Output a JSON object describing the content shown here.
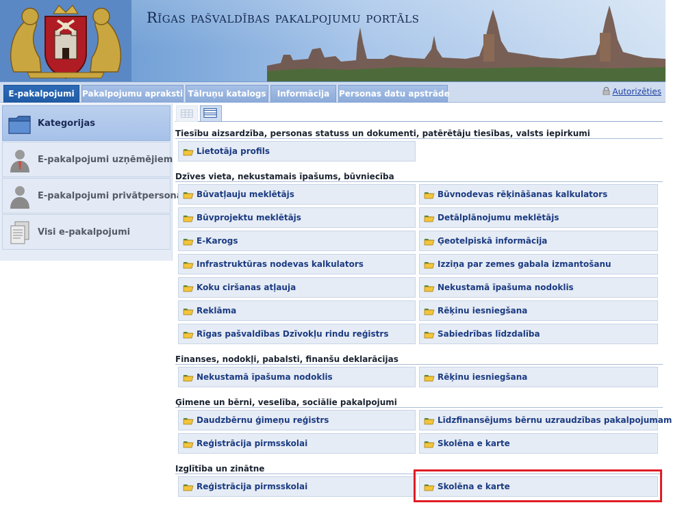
{
  "header": {
    "title": "Rīgas pašvaldības pakalpojumu portāls",
    "coat_of_arms_icon": "riga-coat-of-arms-icon",
    "skyline_icon": "riga-skyline-image"
  },
  "tabs": [
    {
      "label": "E-pakalpojumi",
      "active": true
    },
    {
      "label": "Pakalpojumu apraksti",
      "active": false
    },
    {
      "label": "Tālruņu katalogs",
      "active": false
    },
    {
      "label": "Informācija",
      "active": false
    },
    {
      "label": "Personas datu apstrāde",
      "active": false
    }
  ],
  "auth": {
    "label": "Autorizēties",
    "icon": "lock-icon"
  },
  "sidebar": {
    "items": [
      {
        "label": "Kategorijas",
        "icon": "folder-icon",
        "active": true
      },
      {
        "label": "E-pakalpojumi uzņēmējiem",
        "icon": "business-person-icon",
        "active": false
      },
      {
        "label": "E-pakalpojumi privātpersonām",
        "icon": "person-icon",
        "active": false
      },
      {
        "label": "Visi e-pakalpojumi",
        "icon": "documents-icon",
        "active": false
      }
    ]
  },
  "view_toggle": {
    "options": [
      "list-view",
      "grid-view"
    ],
    "selected": "grid-view"
  },
  "categories": [
    {
      "title": "Tiesību aizsardzība, personas statuss un dokumenti, patērētāju tiesības, valsts iepirkumi",
      "services": [
        "Lietotāja profils"
      ]
    },
    {
      "title": "Dzīves vieta, nekustamais īpašums, būvniecība",
      "services": [
        "Būvatļauju meklētājs",
        "Būvnodevas rēķināšanas kalkulators",
        "Būvprojektu meklētājs",
        "Detālplānojumu meklētājs",
        "E-Karogs",
        "Ģeotelpiskā informācija",
        "Infrastruktūras nodevas kalkulators",
        "Izziņa par zemes gabala izmantošanu",
        "Koku ciršanas atļauja",
        "Nekustamā īpašuma nodoklis",
        "Reklāma",
        "Rēķinu iesniegšana",
        "Rīgas pašvaldības Dzīvokļu rindu reģistrs",
        "Sabiedrības līdzdalība"
      ]
    },
    {
      "title": "Finanses, nodokļi, pabalsti, finanšu deklarācijas",
      "services": [
        "Nekustamā īpašuma nodoklis",
        "Rēķinu iesniegšana"
      ]
    },
    {
      "title": "Ģimene un bērni, veselība, sociālie pakalpojumi",
      "services": [
        "Daudzbērnu ģimeņu reģistrs",
        "Līdzfinansējums bērnu uzraudzības pakalpojumam",
        "Reģistrācija pirmsskolai",
        "Skolēna e karte"
      ]
    },
    {
      "title": "Izglītība un zinātne",
      "services": [
        "Reģistrācija pirmsskolai",
        "Skolēna e karte"
      ]
    }
  ],
  "colors": {
    "accent": "#1f5aa5",
    "link": "#1b3b82",
    "highlight": "#e01b24"
  }
}
